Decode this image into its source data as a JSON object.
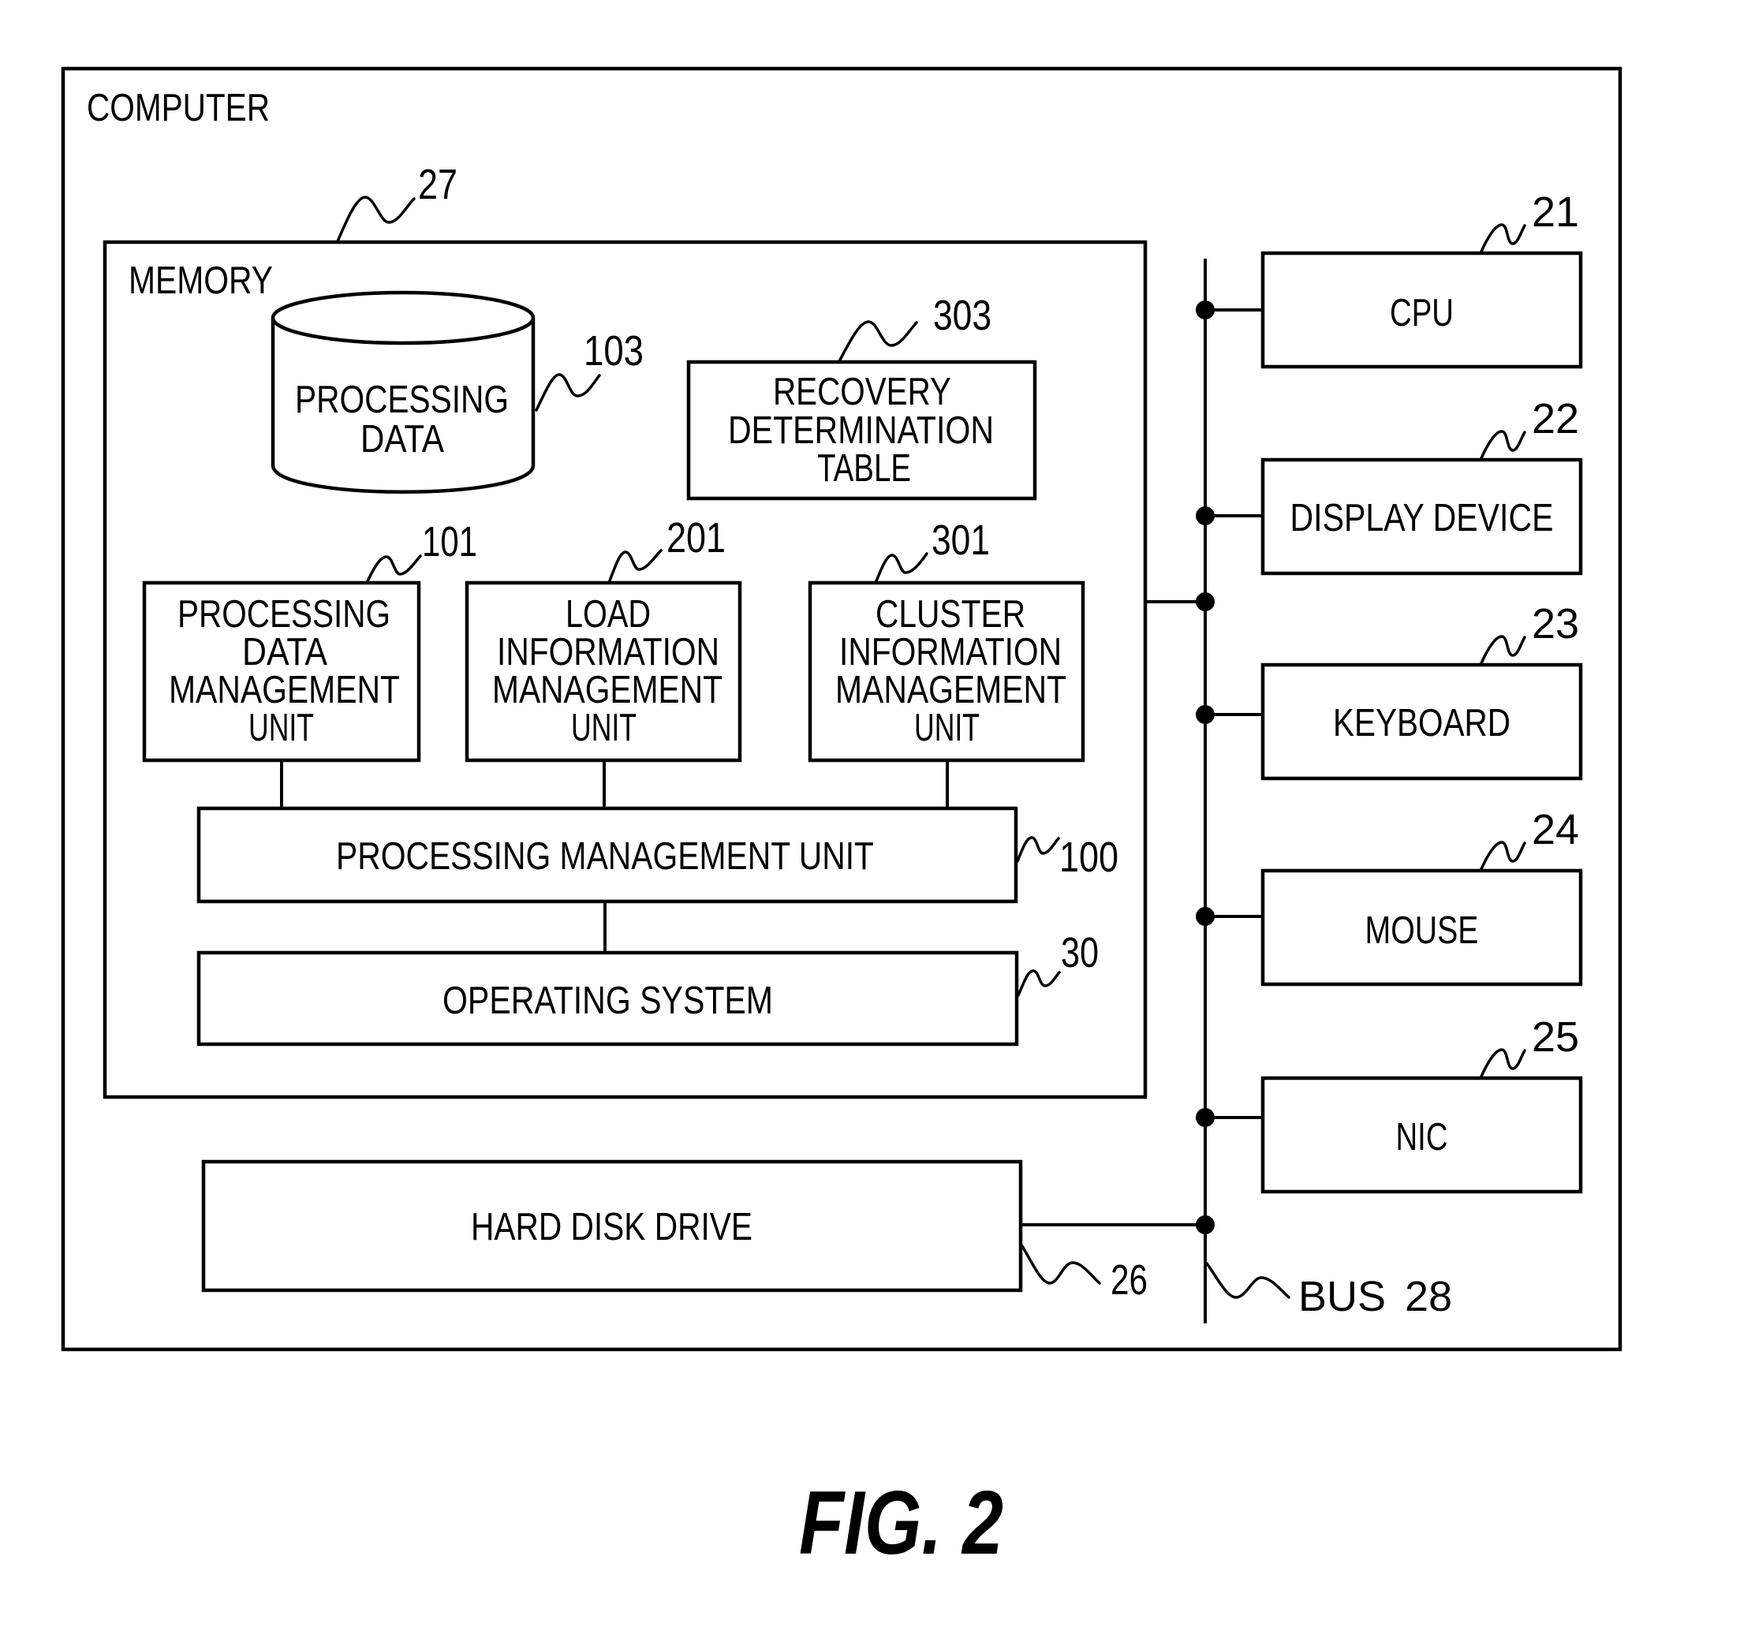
{
  "figure": {
    "caption": "FIG. 2",
    "computer": {
      "label": "COMPUTER"
    },
    "memory": {
      "label": "MEMORY",
      "ref": "27"
    },
    "processing_data": {
      "lines": [
        "PROCESSING",
        "DATA"
      ],
      "ref": "103"
    },
    "recovery_table": {
      "lines": [
        "RECOVERY",
        "DETERMINATION",
        "TABLE"
      ],
      "ref": "303"
    },
    "units": [
      {
        "id": "processing-data-management-unit",
        "lines": [
          "PROCESSING",
          "DATA",
          "MANAGEMENT",
          "UNIT"
        ],
        "ref": "101"
      },
      {
        "id": "load-information-management-unit",
        "lines": [
          "LOAD",
          "INFORMATION",
          "MANAGEMENT",
          "UNIT"
        ],
        "ref": "201"
      },
      {
        "id": "cluster-information-management-unit",
        "lines": [
          "CLUSTER",
          "INFORMATION",
          "MANAGEMENT",
          "UNIT"
        ],
        "ref": "301"
      }
    ],
    "processing_management_unit": {
      "label": "PROCESSING MANAGEMENT UNIT",
      "ref": "100"
    },
    "operating_system": {
      "label": "OPERATING SYSTEM",
      "ref": "30"
    },
    "hard_disk_drive": {
      "label": "HARD DISK DRIVE",
      "ref": "26"
    },
    "bus": {
      "label": "BUS",
      "ref": "28"
    },
    "devices": [
      {
        "id": "cpu",
        "label": "CPU",
        "ref": "21"
      },
      {
        "id": "display-device",
        "label": "DISPLAY DEVICE",
        "ref": "22"
      },
      {
        "id": "keyboard",
        "label": "KEYBOARD",
        "ref": "23"
      },
      {
        "id": "mouse",
        "label": "MOUSE",
        "ref": "24"
      },
      {
        "id": "nic",
        "label": "NIC",
        "ref": "25"
      }
    ]
  }
}
